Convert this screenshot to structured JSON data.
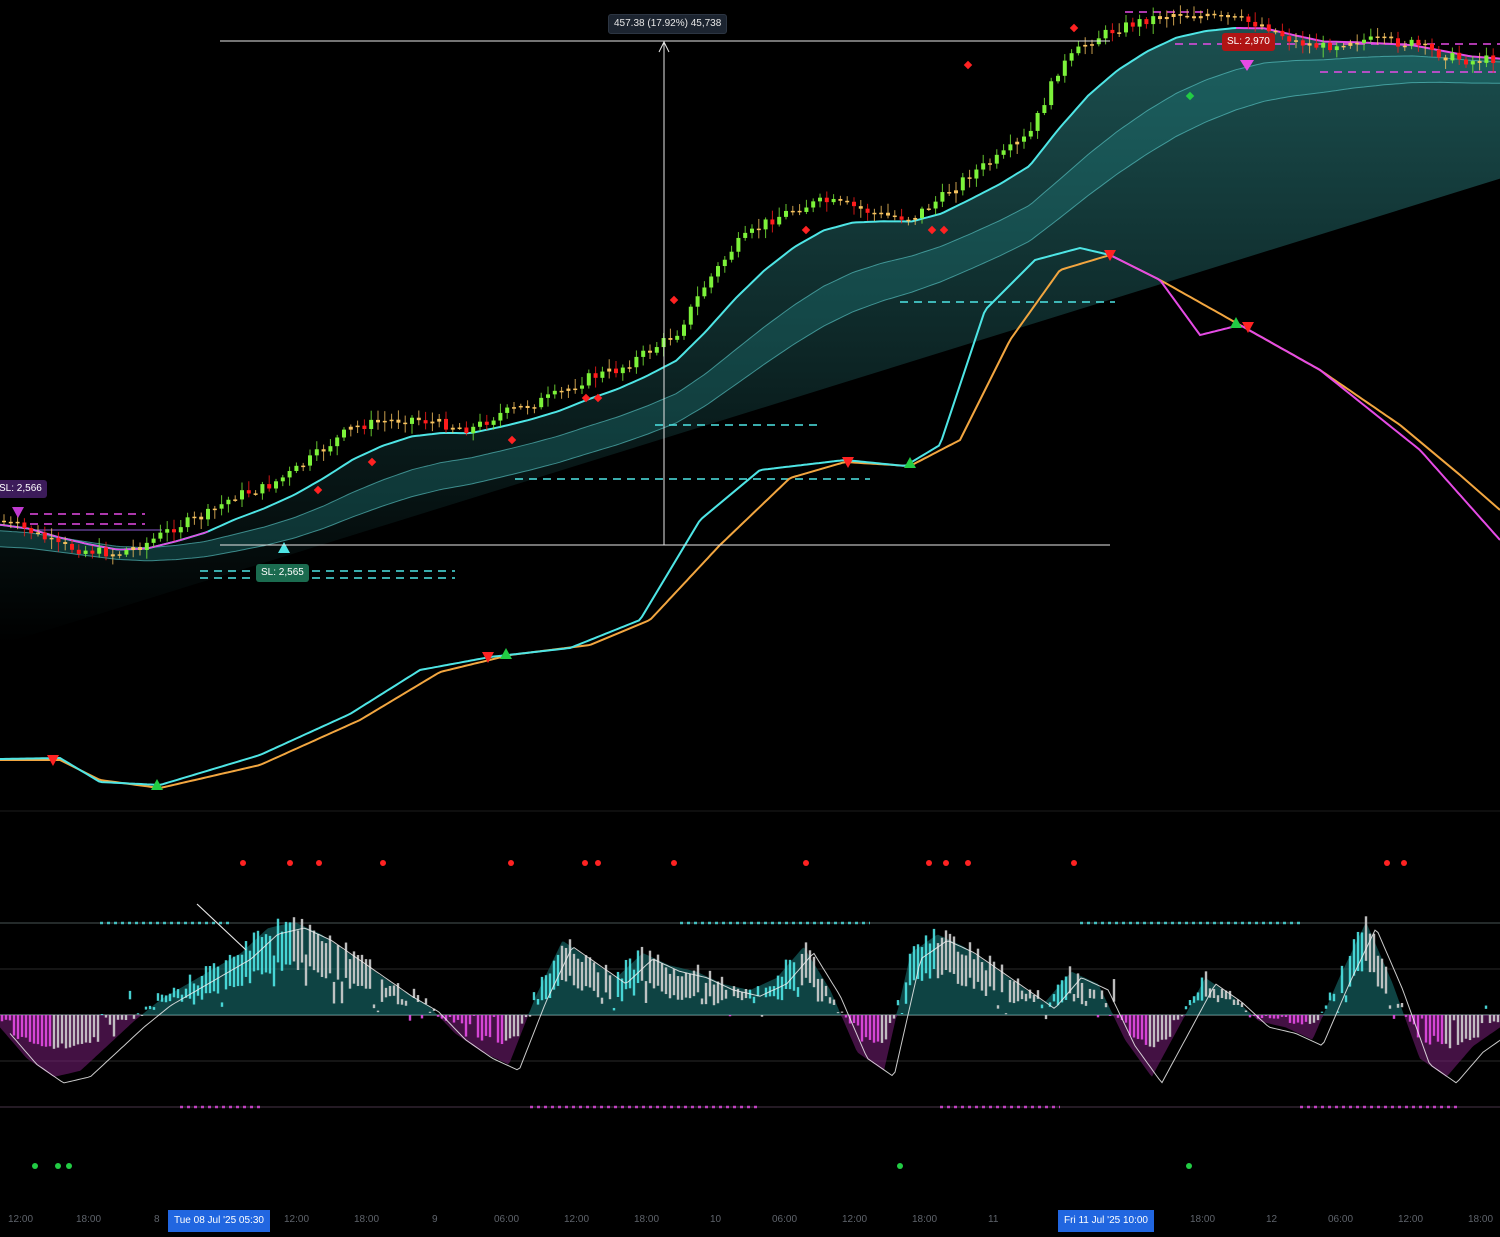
{
  "colors": {
    "background": "#000000",
    "bull": "#7cf23a",
    "bear": "#ff1c1c",
    "neutral": "#f7c35f",
    "cyan": "#4ee5e5",
    "magenta": "#e54be5",
    "orange": "#f2a640",
    "band": "#1f7f7f",
    "oscBullFill": "#1a7a7a",
    "oscBearFill": "#7a1f7a",
    "signalRed": "#ff2222",
    "signalGreen": "#22cc44",
    "highlight": "#2166e0"
  },
  "labels": {
    "measure": "457.38 (17.92%) 45,738",
    "sl_left": "SL: 2,566",
    "sl_mid": "SL: 2,565",
    "sl_right": "SL: 2,970"
  },
  "chart_data": {
    "type": "candlestick",
    "time_axis": {
      "ticks": [
        "12:00",
        "18:00",
        "8",
        "12:00",
        "18:00",
        "9",
        "06:00",
        "12:00",
        "18:00",
        "10",
        "06:00",
        "12:00",
        "18:00",
        "11",
        "18:00",
        "12",
        "06:00",
        "12:00",
        "18:00"
      ],
      "highlight_start": "Tue 08 Jul '25   05:30",
      "highlight_end": "Fri 11 Jul '25   10:00"
    },
    "measurement": {
      "price_change": 457.38,
      "percent_change": 17.92,
      "ticks": 45738
    },
    "stop_levels": [
      2566,
      2565,
      2970
    ],
    "price_close": [
      2575,
      2566,
      2552,
      2548,
      2545,
      2555,
      2570,
      2580,
      2598,
      2605,
      2620,
      2640,
      2660,
      2665,
      2668,
      2663,
      2658,
      2672,
      2680,
      2690,
      2705,
      2712,
      2728,
      2745,
      2790,
      2825,
      2845,
      2858,
      2865,
      2860,
      2852,
      2850,
      2868,
      2890,
      2905,
      2925,
      2985,
      3010,
      3022,
      3030,
      3036,
      3032,
      3030,
      3025,
      3010,
      3005,
      3012,
      3010,
      3008,
      2998,
      2992,
      2995
    ],
    "oscillator": [
      -4,
      -14,
      -20,
      -18,
      -10,
      -2,
      5,
      10,
      15,
      20,
      28,
      30,
      26,
      20,
      14,
      8,
      3,
      -6,
      -12,
      -16,
      6,
      24,
      18,
      12,
      20,
      16,
      14,
      10,
      8,
      12,
      22,
      8,
      -12,
      -18,
      20,
      26,
      22,
      16,
      10,
      4,
      14,
      10,
      -8,
      -20,
      -4,
      12,
      6,
      -2,
      -4,
      -8,
      12,
      30,
      10,
      -14,
      -20,
      -10,
      -4
    ]
  }
}
